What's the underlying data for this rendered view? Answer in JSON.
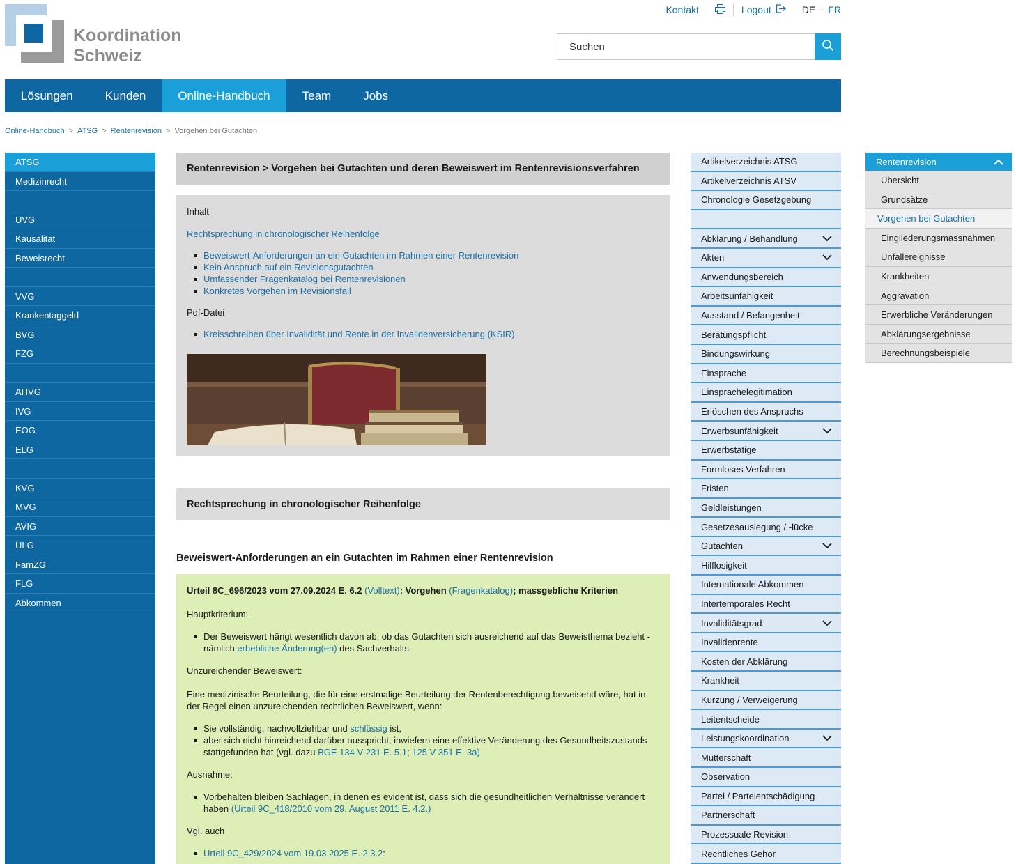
{
  "brand": {
    "line1": "Koordination",
    "line2": "Schweiz"
  },
  "topnav": {
    "kontakt": "Kontakt",
    "logout": "Logout",
    "lang_de": "DE",
    "lang_fr": "FR"
  },
  "search": {
    "placeholder": "Suchen"
  },
  "mainnav": [
    "Lösungen",
    "Kunden",
    "Online-Handbuch",
    "Team",
    "Jobs"
  ],
  "breadcrumb": [
    "Online-Handbuch",
    "ATSG",
    "Rentenrevision",
    "Vorgehen bei Gutachten"
  ],
  "left_sidebar": [
    "ATSG",
    "Medizinrecht",
    "",
    "UVG",
    "Kausalität",
    "Beweisrecht",
    "",
    "VVG",
    "Krankentaggeld",
    "BVG",
    "FZG",
    "",
    "AHVG",
    "IVG",
    "EOG",
    "ELG",
    "",
    "KVG",
    "MVG",
    "AVIG",
    "ÜLG",
    "FamZG",
    "FLG",
    "Abkommen"
  ],
  "article": {
    "title": "Rentenrevision > Vorgehen bei Gutachten und deren Beweiswert im Rentenrevisionsverfahren",
    "toc_label": "Inhalt",
    "toc_link": "Rechtsprechung in chronologischer Reihenfolge",
    "toc_items": [
      "Beweiswert-Anforderungen an ein Gutachten im Rahmen einer Rentenrevision",
      "Kein Anspruch auf ein Revisionsgutachten",
      "Umfassender Fragenkatalog bei Rentenrevisionen",
      "Konkretes Vorgehen im Revisionsfall"
    ],
    "pdf_label": "Pdf-Datei",
    "pdf_items": [
      "Kreisschreiben über Invalidität und Rente in der Invalidenversicherung (KSIR)"
    ],
    "section_title": "Rechtsprechung in chronologischer Reihenfolge",
    "subsection_title": "Beweiswert-Anforderungen an ein Gutachten im Rahmen einer Rentenrevision",
    "case": {
      "ref": "Urteil 8C_696/2023 vom 27.09.2024 E. 6.2",
      "volltext": "(Volltext)",
      "vorgehen": ": Vorgehen",
      "fragenkatalog": "(Fragenkatalog)",
      "kriterien": "; massgebliche Kriterien",
      "hauptkriterium_label": "Hauptkriterium:",
      "hauptkriterium_text": "Der Beweiswert hängt wesentlich davon ab, ob das Gutachten sich ausreichend auf das Beweisthema bezieht - nämlich",
      "hauptkriterium_link": "erhebliche Änderung(en)",
      "hauptkriterium_tail": "des Sachverhalts.",
      "unzureichend_label": "Unzureichender Beweiswert:",
      "unzureichend_text": "Eine medizinische Beurteilung, die für eine erstmalige Beurteilung der Rentenberechtigung beweisend wäre, hat in der Regel einen unzureichenden rechtlichen Beweiswert, wenn:",
      "bullet1_a": "Sie vollständig, nachvollziehbar und",
      "bullet1_link": "schlüssig",
      "bullet1_b": "ist,",
      "bullet2_a": "aber sich nicht hinreichend darüber ausspricht, inwiefern eine effektive Veränderung des Gesundheitszustands stattgefunden hat (vgl. dazu",
      "bullet2_link1": "BGE 134 V 231 E. 5.1",
      "bullet2_sep": ";",
      "bullet2_link2": "125 V 351 E. 3a)",
      "ausnahme_label": "Ausnahme:",
      "ausnahme_text": "Vorbehalten bleiben Sachlagen, in denen es evident ist, dass sich die gesundheitlichen Verhältnisse verändert haben",
      "ausnahme_link": "(Urteil 9C_418/2010 vom 29. August 2011 E. 4.2.)",
      "vgl_label": "Vgl. auch",
      "vgl_link": "Urteil 9C_429/2024 vom 19.03.2025 E. 2.3.2",
      "vgl_tail": ":"
    }
  },
  "right_index": [
    {
      "label": "Artikelverzeichnis ATSG",
      "chevron": false
    },
    {
      "label": "Artikelverzeichnis ATSV",
      "chevron": false
    },
    {
      "label": "Chronologie Gesetzgebung",
      "chevron": false
    },
    {
      "label": "",
      "chevron": false
    },
    {
      "label": "Abklärung / Behandlung",
      "chevron": true
    },
    {
      "label": "Akten",
      "chevron": true
    },
    {
      "label": "Anwendungsbereich",
      "chevron": false
    },
    {
      "label": "Arbeitsunfähigkeit",
      "chevron": false
    },
    {
      "label": "Ausstand / Befangenheit",
      "chevron": false
    },
    {
      "label": "Beratungspflicht",
      "chevron": false
    },
    {
      "label": "Bindungswirkung",
      "chevron": false
    },
    {
      "label": "Einsprache",
      "chevron": false
    },
    {
      "label": "Einsprachelegitimation",
      "chevron": false
    },
    {
      "label": "Erlöschen des Anspruchs",
      "chevron": false
    },
    {
      "label": "Erwerbsunfähigkeit",
      "chevron": true
    },
    {
      "label": "Erwerbstätige",
      "chevron": false
    },
    {
      "label": "Formloses Verfahren",
      "chevron": false
    },
    {
      "label": "Fristen",
      "chevron": false
    },
    {
      "label": "Geldleistungen",
      "chevron": false
    },
    {
      "label": "Gesetzesauslegung / -lücke",
      "chevron": false
    },
    {
      "label": "Gutachten",
      "chevron": true
    },
    {
      "label": "Hilflosigkeit",
      "chevron": false
    },
    {
      "label": "Internationale Abkommen",
      "chevron": false
    },
    {
      "label": "Intertemporales Recht",
      "chevron": false
    },
    {
      "label": "Invaliditätsgrad",
      "chevron": true
    },
    {
      "label": "Invalidenrente",
      "chevron": false
    },
    {
      "label": "Kosten der Abklärung",
      "chevron": false
    },
    {
      "label": "Krankheit",
      "chevron": false
    },
    {
      "label": "Kürzung / Verweigerung",
      "chevron": false
    },
    {
      "label": "Leitentscheide",
      "chevron": false
    },
    {
      "label": "Leistungskoordination",
      "chevron": true
    },
    {
      "label": "Mutterschaft",
      "chevron": false
    },
    {
      "label": "Observation",
      "chevron": false
    },
    {
      "label": "Partei / Parteientschädigung",
      "chevron": false
    },
    {
      "label": "Partnerschaft",
      "chevron": false
    },
    {
      "label": "Prozessuale Revision",
      "chevron": false
    },
    {
      "label": "Rechtliches Gehör",
      "chevron": false
    }
  ],
  "far_right": {
    "title": "Rentenrevision",
    "items": [
      "Übersicht",
      "Grundsätze",
      "Vorgehen bei Gutachten",
      "Eingliederungsmassnahmen",
      "Unfallereignisse",
      "Krankheiten",
      "Aggravation",
      "Erwerbliche Veränderungen",
      "Abklärungsergebnisse",
      "Berechnungsbeispiele"
    ],
    "active_index": 2
  },
  "colors": {
    "primary": "#0f67a1",
    "accent": "#1a9fd8",
    "green_box": "#ddefb7",
    "link": "#1a6fa8"
  }
}
